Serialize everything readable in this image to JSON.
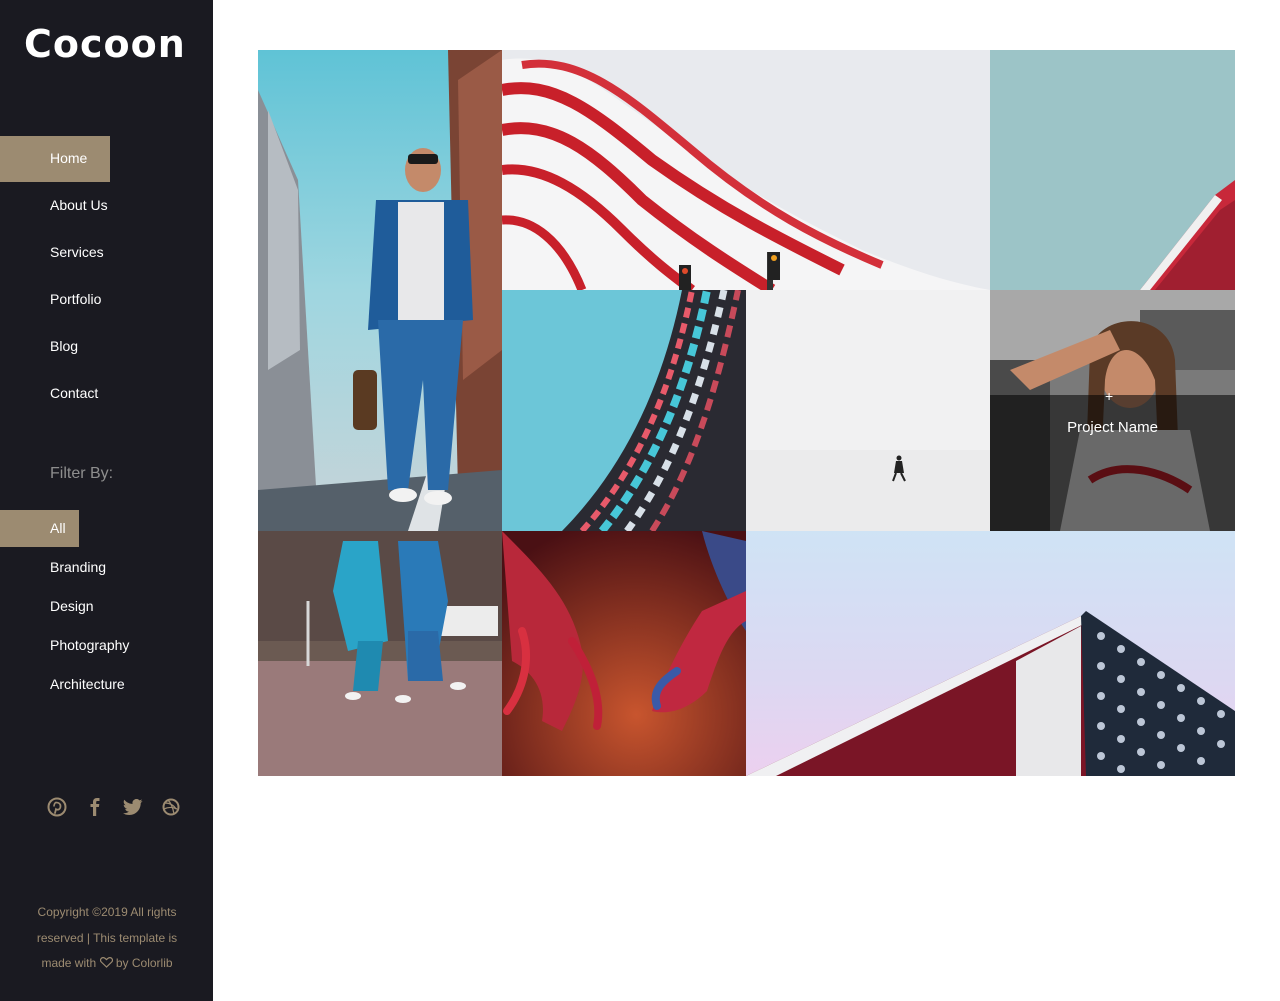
{
  "brand": {
    "logo_text": "Cocoon"
  },
  "nav": {
    "items": [
      {
        "label": "Home",
        "active": true
      },
      {
        "label": "About Us",
        "active": false
      },
      {
        "label": "Services",
        "active": false
      },
      {
        "label": "Portfolio",
        "active": false
      },
      {
        "label": "Blog",
        "active": false
      },
      {
        "label": "Contact",
        "active": false
      }
    ]
  },
  "filter": {
    "title": "Filter By:",
    "items": [
      {
        "label": "All",
        "active": true
      },
      {
        "label": "Branding",
        "active": false
      },
      {
        "label": "Design",
        "active": false
      },
      {
        "label": "Photography",
        "active": false
      },
      {
        "label": "Architecture",
        "active": false
      }
    ]
  },
  "social": {
    "icons": [
      "pinterest-icon",
      "facebook-icon",
      "twitter-icon",
      "dribbble-icon"
    ]
  },
  "footer": {
    "line1": "Copyright ©2019 All rights",
    "line2": "reserved | This template is",
    "line3_prefix": "made with",
    "line3_suffix": "by Colorlib"
  },
  "gallery": {
    "hover_title": "Project Name",
    "hover_plus": "+"
  },
  "colors": {
    "sidebar_bg": "#1a1a21",
    "accent": "#9c8b71",
    "text_light": "#ffffff"
  }
}
